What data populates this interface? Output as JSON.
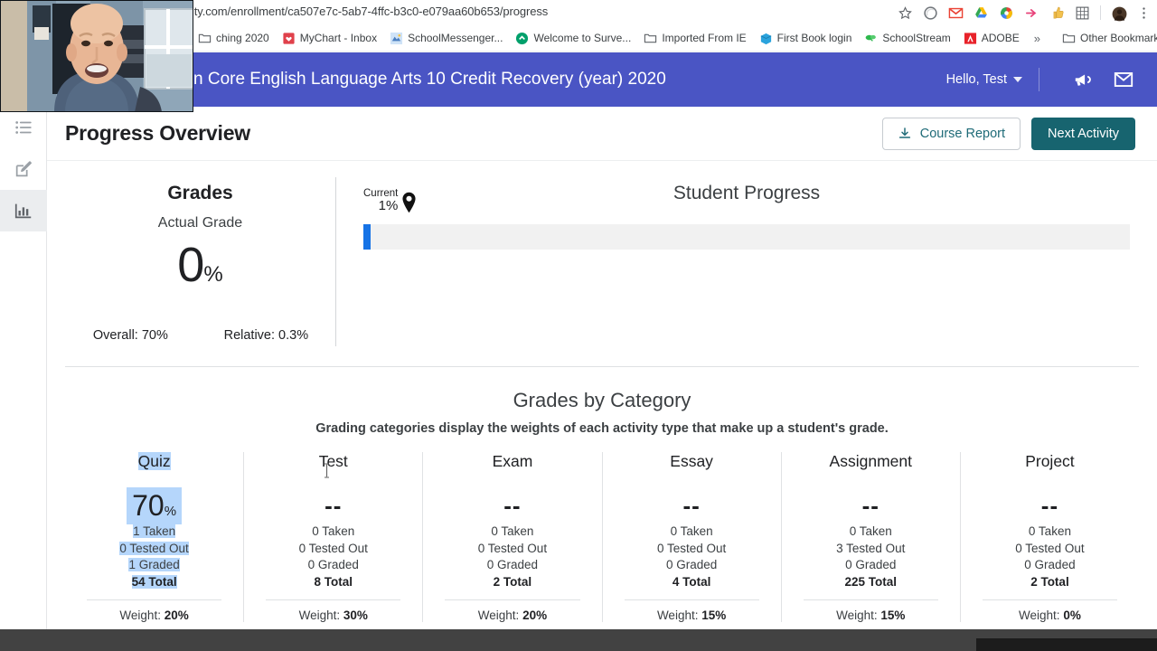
{
  "browser": {
    "url": "ity.com/enrollment/ca507e7c-5ab7-4ffc-b3c0-e079aa60b653/progress",
    "omni_icons": [
      {
        "name": "bookmark-star-icon"
      },
      {
        "name": "circle-extension-icon"
      },
      {
        "name": "gmail-icon"
      },
      {
        "name": "google-drive-icon"
      },
      {
        "name": "compass-extension-icon"
      },
      {
        "name": "red-arrow-extension-icon"
      },
      {
        "name": "thumbs-up-extension-icon"
      },
      {
        "name": "grid-apps-icon"
      },
      {
        "name": "profile-avatar-icon"
      },
      {
        "name": "chrome-menu-icon"
      }
    ],
    "bookmarks": [
      {
        "label": "ching 2020",
        "icon": "folder-icon"
      },
      {
        "label": "MyChart - Inbox",
        "icon": "mychart-icon"
      },
      {
        "label": "SchoolMessenger...",
        "icon": "schoolmessenger-icon"
      },
      {
        "label": "Welcome to Surve...",
        "icon": "survey-icon"
      },
      {
        "label": "Imported From IE",
        "icon": "folder-icon"
      },
      {
        "label": "First Book login",
        "icon": "firstbook-icon"
      },
      {
        "label": "SchoolStream",
        "icon": "schoolstream-icon"
      },
      {
        "label": "ADOBE",
        "icon": "adobe-icon"
      }
    ],
    "overflow_label": "»",
    "other_bookmarks": {
      "label": "Other Bookmarks",
      "icon": "folder-icon"
    }
  },
  "app_header": {
    "course_title": "n Core English Language Arts 10 Credit Recovery (year) 2020",
    "user_menu": "Hello, Test",
    "announcement_icon": "megaphone-icon",
    "mail_icon": "envelope-icon",
    "bg_color": "#4a55c4"
  },
  "sidebar": {
    "items": [
      {
        "name": "sidebar-item-course-list",
        "icon": "list-icon",
        "active": false
      },
      {
        "name": "sidebar-item-edit",
        "icon": "pencil-square-icon",
        "active": false
      },
      {
        "name": "sidebar-item-progress",
        "icon": "bar-chart-icon",
        "active": true
      }
    ]
  },
  "page": {
    "title": "Progress Overview",
    "course_report_button": "Course Report",
    "course_report_icon": "download-icon",
    "next_activity_button": "Next Activity",
    "accent_color": "#17646f"
  },
  "grades": {
    "title": "Grades",
    "subtitle": "Actual Grade",
    "value": "0",
    "value_suffix": "%",
    "overall": "Overall: 70%",
    "relative": "Relative: 0.3%"
  },
  "student_progress": {
    "title": "Student Progress",
    "marker_label": "Current",
    "marker_value": "1%",
    "percent": 1,
    "fill_color": "#1673e6",
    "track_color": "#f1f1f1"
  },
  "categories_section": {
    "title": "Grades by Category",
    "subtitle": "Grading categories display the weights of each activity type that make up a student's grade.",
    "labels": {
      "taken": "Taken",
      "tested_out": "Tested Out",
      "graded": "Graded",
      "total": "Total",
      "weight_prefix": "Weight:"
    },
    "columns": [
      {
        "name": "Quiz",
        "score": "70",
        "score_suffix": "%",
        "has_score": true,
        "taken": "1 Taken",
        "tested_out": "0 Tested Out",
        "graded": "1 Graded",
        "total": "54 Total",
        "weight": "20%",
        "selected": true
      },
      {
        "name": "Test",
        "score": "--",
        "score_suffix": "",
        "has_score": false,
        "taken": "0 Taken",
        "tested_out": "0 Tested Out",
        "graded": "0 Graded",
        "total": "8 Total",
        "weight": "30%",
        "selected": false
      },
      {
        "name": "Exam",
        "score": "--",
        "score_suffix": "",
        "has_score": false,
        "taken": "0 Taken",
        "tested_out": "0 Tested Out",
        "graded": "0 Graded",
        "total": "2 Total",
        "weight": "20%",
        "selected": false
      },
      {
        "name": "Essay",
        "score": "--",
        "score_suffix": "",
        "has_score": false,
        "taken": "0 Taken",
        "tested_out": "0 Tested Out",
        "graded": "0 Graded",
        "total": "4 Total",
        "weight": "15%",
        "selected": false
      },
      {
        "name": "Assignment",
        "score": "--",
        "score_suffix": "",
        "has_score": false,
        "taken": "0 Taken",
        "tested_out": "3 Tested Out",
        "graded": "0 Graded",
        "total": "225 Total",
        "weight": "15%",
        "selected": false
      },
      {
        "name": "Project",
        "score": "--",
        "score_suffix": "",
        "has_score": false,
        "taken": "0 Taken",
        "tested_out": "0 Tested Out",
        "graded": "0 Graded",
        "total": "2 Total",
        "weight": "0%",
        "selected": false
      }
    ]
  },
  "overlay": {
    "webcam_label": "webcam-video-overlay",
    "video_bar_label": "video-player-bar"
  }
}
